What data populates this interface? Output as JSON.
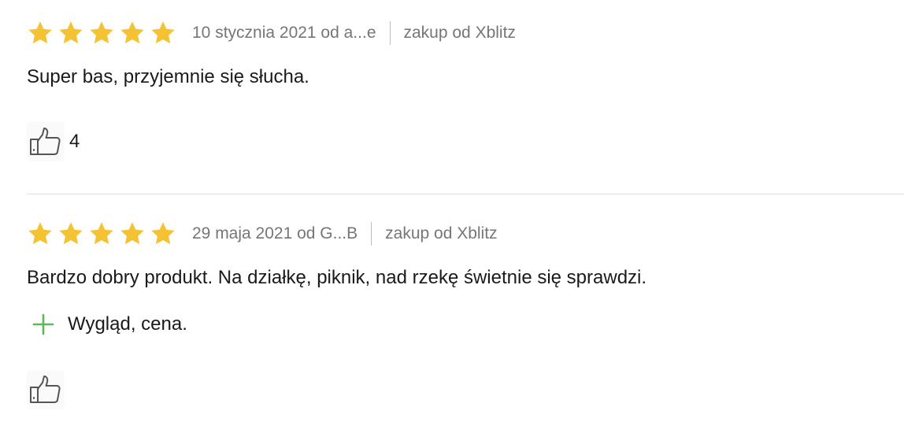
{
  "reviews": [
    {
      "rating": 5,
      "max_rating": 5,
      "date_author": "10 stycznia 2021 od a...e",
      "source": "zakup od Xblitz",
      "text": "Super bas, przyjemnie się słucha.",
      "pros": [],
      "helpful_count": "4"
    },
    {
      "rating": 5,
      "max_rating": 5,
      "date_author": "29 maja 2021 od G...B",
      "source": "zakup od Xblitz",
      "text": "Bardzo dobry produkt. Na działkę, piknik, nad rzekę świetnie się sprawdzi.",
      "pros": [
        "Wygląd, cena."
      ],
      "helpful_count": ""
    }
  ],
  "colors": {
    "star": "#f5c234",
    "pro_icon": "#5cb85c",
    "meta_text": "#767676",
    "divider": "#dcdcdc"
  },
  "icons": {
    "star": "star-icon",
    "pro": "plus-icon",
    "helpful": "thumbs-up-icon"
  }
}
